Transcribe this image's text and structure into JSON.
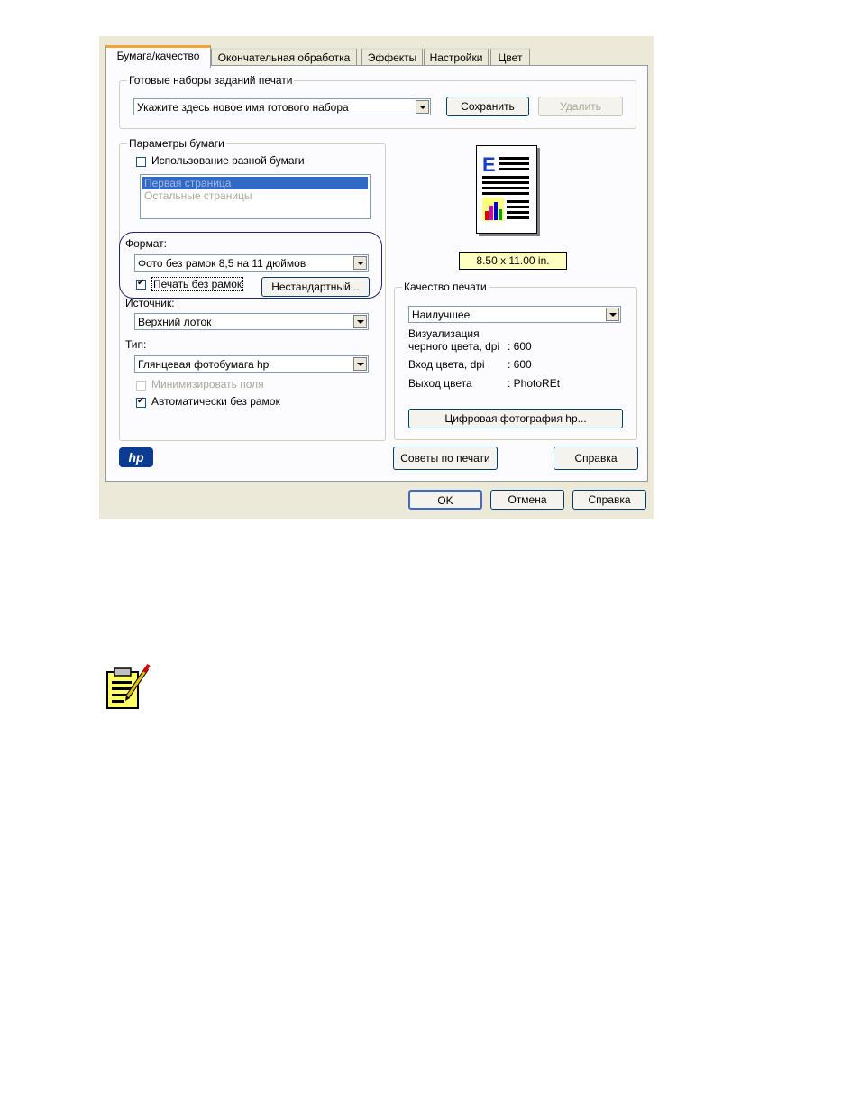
{
  "tabs": [
    {
      "label": "Бумага/качество"
    },
    {
      "label": "Окончательная обработка"
    },
    {
      "label": "Эффекты"
    },
    {
      "label": "Настройки"
    },
    {
      "label": "Цвет"
    }
  ],
  "presets": {
    "legend": "Готовые наборы заданий печати",
    "combo_value": "Укажите здесь новое имя готового набора",
    "save_label": "Сохранить",
    "delete_label": "Удалить"
  },
  "paper": {
    "legend": "Параметры бумаги",
    "different_paper_label": "Использование разной бумаги",
    "list_items": [
      "Первая страница",
      "Остальные страницы"
    ],
    "format_label": "Формат:",
    "format_value": "Фото без рамок 8,5 на 11 дюймов",
    "borderless_label": "Печать без рамок",
    "custom_label": "Нестандартный...",
    "source_label": "Источник:",
    "source_value": "Верхний лоток",
    "type_label": "Тип:",
    "type_value": "Глянцевая фотобумага hp",
    "minimize_margins_label": "Минимизировать поля",
    "auto_borderless_label": "Автоматически без рамок"
  },
  "preview": {
    "size_label": "8.50 x 11.00 in."
  },
  "quality": {
    "legend": "Качество печати",
    "combo_value": "Наилучшее",
    "row1_label_a": "Визуализация",
    "row1_label_b": "черного цвета, dpi",
    "row1_value": ": 600",
    "row2_label": "Вход цвета, dpi",
    "row2_value": ": 600",
    "row3_label": "Выход цвета",
    "row3_value": ": PhotoREt",
    "digital_photo_label": "Цифровая фотография hp..."
  },
  "footer": {
    "logo_text": "hp",
    "tips_label": "Советы по печати",
    "help_label": "Справка"
  },
  "dialog_buttons": {
    "ok_label": "OK",
    "cancel_label": "Отмена",
    "help_label": "Справка"
  },
  "colors": {
    "accent_tab": "#f4a336",
    "selection": "#316ac5",
    "size_badge_bg": "#ffffc0"
  }
}
